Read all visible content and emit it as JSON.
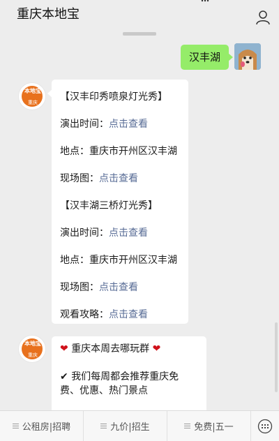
{
  "header": {
    "title": "重庆本地宝"
  },
  "user_message": {
    "text": "汉丰湖"
  },
  "bot_reply": {
    "lines": [
      {
        "label": "【汉丰印秀喷泉灯光秀】",
        "link": ""
      },
      {
        "label": "演出时间：",
        "link": "点击查看"
      },
      {
        "label": "地点：重庆市开州区汉丰湖",
        "link": ""
      },
      {
        "label": "现场图：",
        "link": "点击查看"
      },
      {
        "label": "【汉丰湖三桥灯光秀】",
        "link": ""
      },
      {
        "label": "演出时间：",
        "link": "点击查看"
      },
      {
        "label": "地点：重庆市开州区汉丰湖",
        "link": ""
      },
      {
        "label": "现场图：",
        "link": "点击查看"
      },
      {
        "label": "观看攻略：",
        "link": "点击查看"
      }
    ]
  },
  "bot_reply2": {
    "line1": "重庆本周去哪玩群",
    "line2": "我们每周都会推荐重庆免费、优惠、热门景点"
  },
  "bot_avatar": {
    "brand": "本地宝",
    "city": "重庆"
  },
  "bottom_menu": [
    {
      "label": "公租房|招聘"
    },
    {
      "label": "九价|招生"
    },
    {
      "label": "免费|五一"
    }
  ],
  "colors": {
    "link": "#576b95",
    "green_bubble": "#95ec69",
    "heart": "#d0121b"
  }
}
